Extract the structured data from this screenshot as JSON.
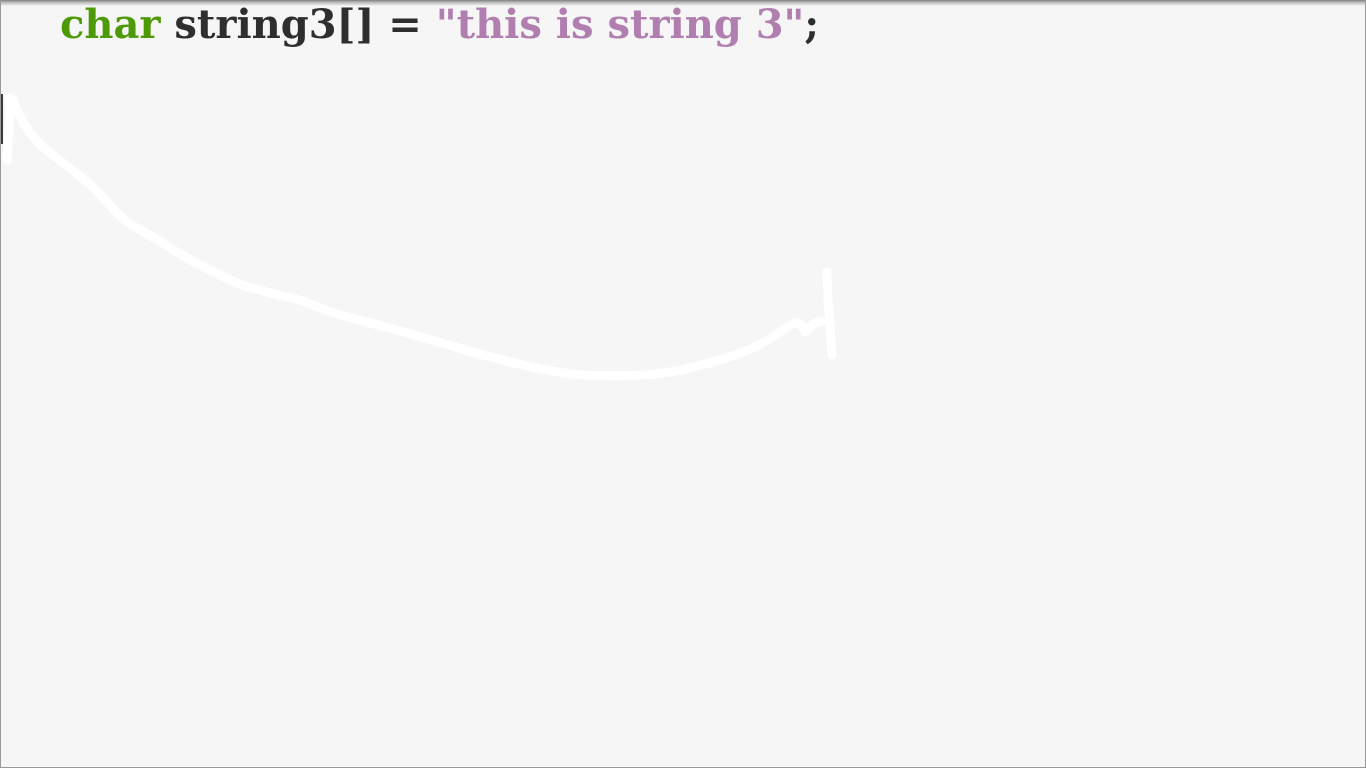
{
  "code_line": {
    "keyword": "char",
    "identifier": "string3[] =",
    "string_literal": "\"this is string 3\"",
    "terminator": ";"
  },
  "colors": {
    "background": "#f6f6f6",
    "keyword": "#4e9a06",
    "string_literal": "#b07faf",
    "plain_text": "#2e2e2e",
    "annotation_stroke": "#ffffff"
  }
}
